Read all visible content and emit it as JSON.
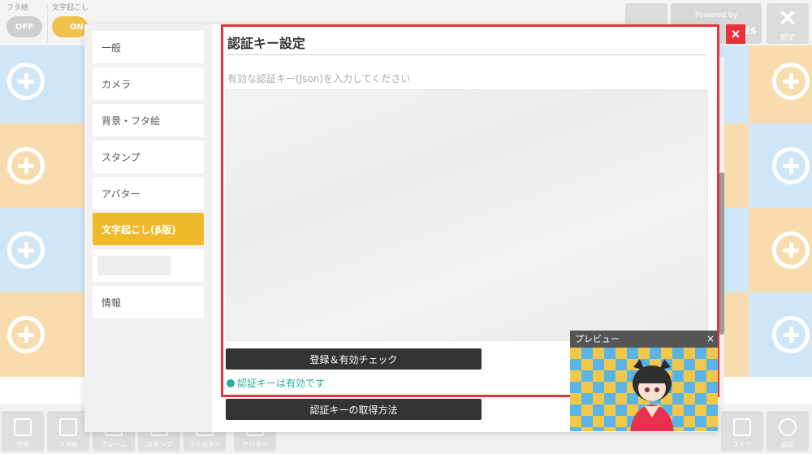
{
  "topbar": {
    "futae_label": "フタ絵",
    "futae_state": "OFF",
    "moji_label": "文字起こし",
    "moji_state": "ON",
    "powered_by": "Powered by",
    "powered_suffix": "ES",
    "close_label": "閉ず"
  },
  "sidebar": {
    "items": [
      {
        "label": "一般"
      },
      {
        "label": "カメラ"
      },
      {
        "label": "背景・フタ絵"
      },
      {
        "label": "スタンプ"
      },
      {
        "label": "アバター"
      },
      {
        "label": "文字起こし(β版)"
      },
      {
        "label": ""
      },
      {
        "label": "情報"
      }
    ],
    "active_index": 5
  },
  "content": {
    "title": "認証キー設定",
    "input_label": "有効な認証キー(Json)を入力してください",
    "json_value": "",
    "register_button": "登録＆有効チェック",
    "status_text": "認証キーは有効です",
    "howto_button": "認証キーの取得方法"
  },
  "preview": {
    "title": "プレビュー",
    "close_icon": "×"
  },
  "bottombar": {
    "buttons": [
      "背景",
      "フタ絵",
      "フレーム",
      "スタンプ",
      "フィルター",
      "アバター"
    ],
    "store_label": "ストア",
    "settings_label": "設定"
  },
  "colors": {
    "accent": "#efb92b",
    "highlight": "#e8313a",
    "status": "#2aab9c"
  }
}
